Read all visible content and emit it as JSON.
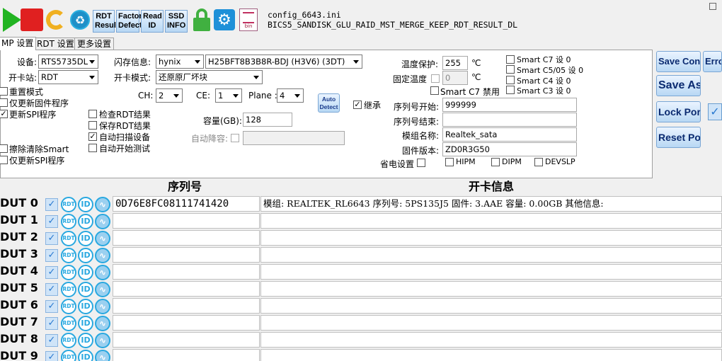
{
  "toolbar": {
    "rdt_result": [
      "RDT",
      "Result"
    ],
    "factory_defect": [
      "Factory",
      "Defect"
    ],
    "read_id": [
      "Read",
      "ID"
    ],
    "ssd_info": [
      "SSD",
      "INFO"
    ],
    "bin_icon_text": "bin",
    "config_file": "config_6643.ini",
    "config_name": "BICS5_SANDISK_GLU_RAID_MST_MERGE_KEEP_RDT_RESULT_DL"
  },
  "tabs": [
    "MP 设置",
    "RDT 设置",
    "更多设置"
  ],
  "settings": {
    "device_label": "设备:",
    "device_value": "RTS5735DL",
    "station_label": "开卡站:",
    "station_value": "RDT",
    "flash_label": "闪存信息:",
    "flash_vendor": "hynix",
    "flash_part": "H25BFT8B3B8R-BDJ (H3V6) (3DT)",
    "mode_label": "开卡模式:",
    "mode_value": "还原原厂坏块",
    "ch_label": "CH:",
    "ch_value": "2",
    "ce_label": "CE:",
    "ce_value": "1",
    "plane_label": "Plane :",
    "plane_value": "4",
    "auto_detect": [
      "Auto",
      "Detect"
    ],
    "capacity_label": "容量(GB):",
    "capacity_value": "128",
    "auto_reduce_label": "自动降容:",
    "temp_protect_label": "温度保护:",
    "temp_protect_value": "255",
    "temp_unit": "℃",
    "fixed_temp_label": "固定温度",
    "fixed_temp_value": "0",
    "inherit_label": "继承",
    "serial_start_label": "序列号开始:",
    "serial_start_value": "999999",
    "serial_end_label": "序列号结束:",
    "module_name_label": "模组名称:",
    "module_name_value": "Realtek_sata",
    "firmware_label": "固件版本:",
    "firmware_value": "ZD0R3G50",
    "power_save_label": "省电设置",
    "hipm": "HIPM",
    "dipm": "DIPM",
    "devslp": "DEVSLP",
    "smart_c7_disable": "Smart C7 禁用",
    "smart_list": [
      "Smart C7 设 0",
      "Smart C5/05 设 0",
      "Smart C4 设 0",
      "Smart C3 设 0"
    ],
    "left_checks": [
      {
        "label": "重置模式",
        "checked": false
      },
      {
        "label": "仅更新固件程序",
        "checked": false
      },
      {
        "label": "更新SPI程序",
        "checked": true
      }
    ],
    "left_checks_bottom": [
      {
        "label": "擦除清除Smart",
        "checked": false
      },
      {
        "label": "仅更新SPI程序",
        "checked": false
      }
    ],
    "mid_checks": [
      {
        "label": "检查RDT结果",
        "checked": false
      },
      {
        "label": "保存RDT结果",
        "checked": false
      },
      {
        "label": "自动扫描设备",
        "checked": true
      },
      {
        "label": "自动开始测试",
        "checked": false
      }
    ]
  },
  "right_buttons": {
    "save_config": "Save Config",
    "error": "Error",
    "save_as": "Save As",
    "lock_port": "Lock Port",
    "reset_port": "Reset Port"
  },
  "table": {
    "serial_header": "序列号",
    "info_header": "开卡信息",
    "rdt_icon": "RDT",
    "id_icon": "ID",
    "rows": [
      {
        "dut": "DUT 0",
        "serial": "0D76E8FC08111741420",
        "info": "模组: REALTEK_RL6643  序列号: 5PS135J5  固件: 3.AAE  容量: 0.00GB  其他信息:"
      },
      {
        "dut": "DUT 1",
        "serial": "",
        "info": ""
      },
      {
        "dut": "DUT 2",
        "serial": "",
        "info": ""
      },
      {
        "dut": "DUT 3",
        "serial": "",
        "info": ""
      },
      {
        "dut": "DUT 4",
        "serial": "",
        "info": ""
      },
      {
        "dut": "DUT 5",
        "serial": "",
        "info": ""
      },
      {
        "dut": "DUT 6",
        "serial": "",
        "info": ""
      },
      {
        "dut": "DUT 7",
        "serial": "",
        "info": ""
      },
      {
        "dut": "DUT 8",
        "serial": "",
        "info": ""
      },
      {
        "dut": "DUT 9",
        "serial": "",
        "info": ""
      }
    ]
  }
}
